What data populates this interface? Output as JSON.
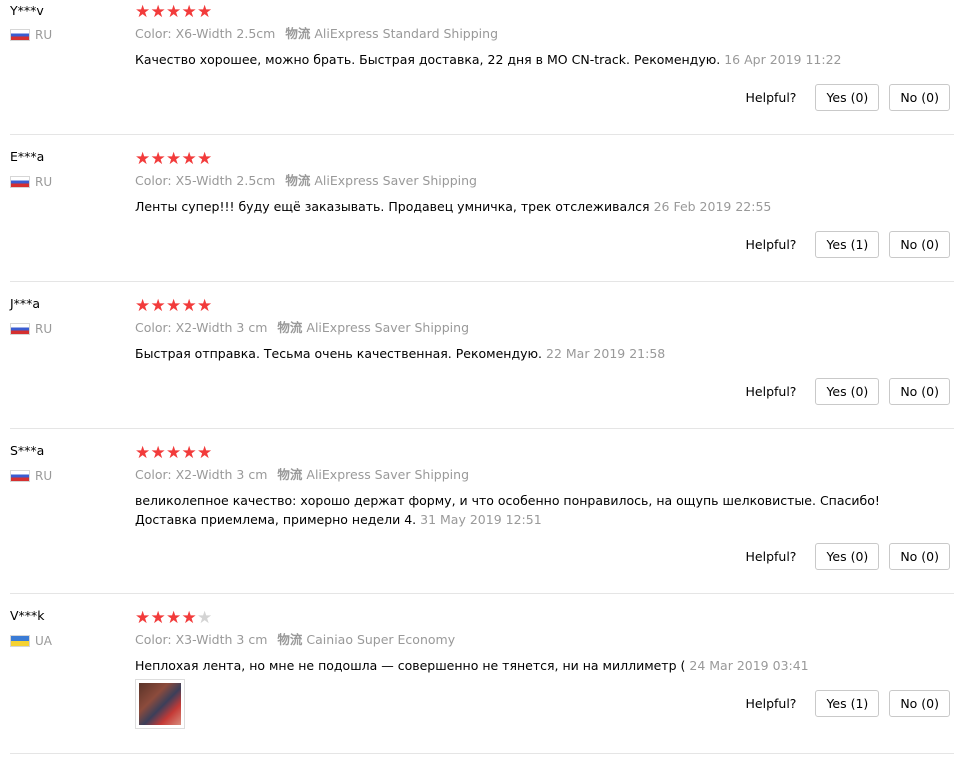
{
  "labels": {
    "helpful": "Helpful?",
    "logistics": "物流"
  },
  "star_color": "#f23b3b",
  "reviews": [
    {
      "user": "Y***v",
      "country": "RU",
      "rating": 5,
      "color": "Color: X6-Width 2.5cm",
      "shipping": "AliExpress Standard Shipping",
      "feedback": "Качество хорошее, можно брать. Быстрая доставка, 22 дня в МО CN-track. Рекомендую.",
      "date": "16 Apr 2019 11:22",
      "yes": "Yes (0)",
      "no": "No (0)"
    },
    {
      "user": "E***a",
      "country": "RU",
      "rating": 5,
      "color": "Color: X5-Width 2.5cm",
      "shipping": "AliExpress Saver Shipping",
      "feedback": "Ленты супер!!! буду ещё заказывать. Продавец умничка, трек отслеживался",
      "date": "26 Feb 2019 22:55",
      "yes": "Yes (1)",
      "no": "No (0)"
    },
    {
      "user": "J***a",
      "country": "RU",
      "rating": 5,
      "color": "Color: X2-Width 3 cm",
      "shipping": "AliExpress Saver Shipping",
      "feedback": "Быстрая отправка. Тесьма очень качественная. Рекомендую.",
      "date": "22 Mar 2019 21:58",
      "yes": "Yes (0)",
      "no": "No (0)"
    },
    {
      "user": "S***a",
      "country": "RU",
      "rating": 5,
      "color": "Color: X2-Width 3 cm",
      "shipping": "AliExpress Saver Shipping",
      "feedback_line1": "великолепное качество: хорошо держат форму, и что особенно понравилось, на ощупь шелковистые. Спасибо!",
      "feedback_line2": "Доставка приемлема, примерно недели 4.",
      "date": "31 May 2019 12:51",
      "yes": "Yes (0)",
      "no": "No (0)"
    },
    {
      "user": "V***k",
      "country": "UA",
      "rating": 4,
      "color": "Color: X3-Width 3 cm",
      "shipping": "Cainiao Super Economy",
      "feedback": "Неплохая лента, но мне не подошла — совершенно не тянется, ни на миллиметр (",
      "date": "24 Mar 2019 03:41",
      "yes": "Yes (1)",
      "no": "No (0)"
    }
  ]
}
